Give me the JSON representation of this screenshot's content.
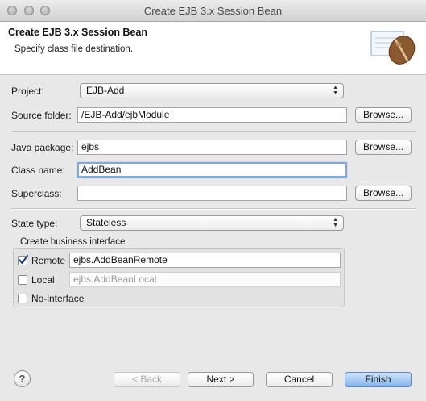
{
  "window": {
    "title": "Create EJB 3.x Session Bean"
  },
  "header": {
    "title": "Create EJB 3.x Session Bean",
    "subtitle": "Specify class file destination."
  },
  "form": {
    "project": {
      "label": "Project:",
      "value": "EJB-Add"
    },
    "source_folder": {
      "label": "Source folder:",
      "value": "/EJB-Add/ejbModule",
      "button": "Browse..."
    },
    "java_package": {
      "label": "Java package:",
      "value": "ejbs",
      "button": "Browse..."
    },
    "class_name": {
      "label": "Class name:",
      "value": "AddBean"
    },
    "superclass": {
      "label": "Superclass:",
      "value": "",
      "button": "Browse..."
    },
    "state_type": {
      "label": "State type:",
      "value": "Stateless"
    }
  },
  "business_interface": {
    "legend": "Create business interface",
    "remote": {
      "label": "Remote",
      "checked": true,
      "value": "ejbs.AddBeanRemote"
    },
    "local": {
      "label": "Local",
      "checked": false,
      "value": "ejbs.AddBeanLocal"
    },
    "no_interface": {
      "label": "No-interface",
      "checked": false
    }
  },
  "footer": {
    "help": "?",
    "back": "< Back",
    "next": "Next >",
    "cancel": "Cancel",
    "finish": "Finish"
  },
  "colors": {
    "finish_button": "#84b4ea",
    "focus_ring": "#7fa8dd",
    "checkmark": "#1d3f8a"
  },
  "icons": {
    "header_banner": "coffee-bean-icon",
    "help": "help-icon"
  }
}
